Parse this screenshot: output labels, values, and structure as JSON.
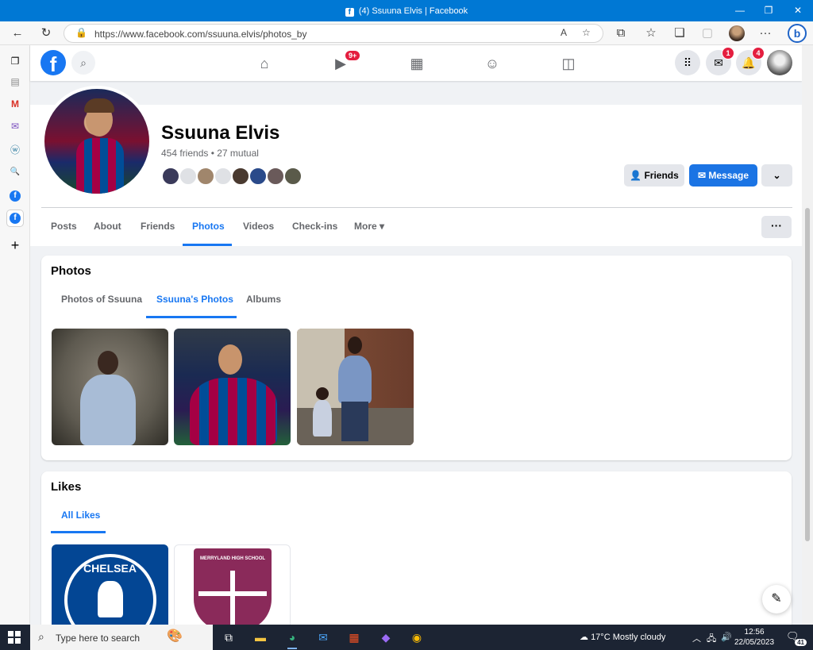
{
  "window": {
    "title": "(4) Ssuuna Elvis | Facebook",
    "minimize": "—",
    "maximize": "❐",
    "close": "✕"
  },
  "browser": {
    "url": "https://www.facebook.com/ssuuna.elvis/photos_by",
    "more": "···",
    "bing": "b"
  },
  "fb_header": {
    "logo": "f",
    "watch_badge": "9+",
    "messenger_badge": "1",
    "notifications_badge": "4"
  },
  "profile": {
    "name": "Ssuuna Elvis",
    "friends_text": "454 friends • 27 mutual",
    "friends_button": "Friends",
    "message_button": "Message",
    "dropdown": "⌄",
    "more_options": "···"
  },
  "tabs": [
    {
      "label": "Posts"
    },
    {
      "label": "About"
    },
    {
      "label": "Friends"
    },
    {
      "label": "Photos"
    },
    {
      "label": "Videos"
    },
    {
      "label": "Check-ins"
    },
    {
      "label": "More ▾"
    }
  ],
  "photos_section": {
    "title": "Photos",
    "subtabs": [
      "Photos of Ssuuna",
      "Ssuuna's Photos",
      "Albums"
    ],
    "active_subtab": "Ssuuna's Photos"
  },
  "likes_section": {
    "title": "Likes",
    "subtabs": [
      "All Likes"
    ],
    "likes": [
      {
        "crest_text": "CHELSEA"
      },
      {
        "crest_text": "MERRYLAND HIGH SCHOOL"
      }
    ]
  },
  "taskbar": {
    "search_placeholder": "Type here to search",
    "weather": "17°C  Mostly cloudy",
    "time": "12:56",
    "date": "22/05/2023",
    "notifications": "41"
  },
  "colors": {
    "fb_blue": "#1877f2",
    "edge_title": "#0078d4",
    "badge_red": "#e41e3f",
    "taskbar": "#1c2433"
  }
}
